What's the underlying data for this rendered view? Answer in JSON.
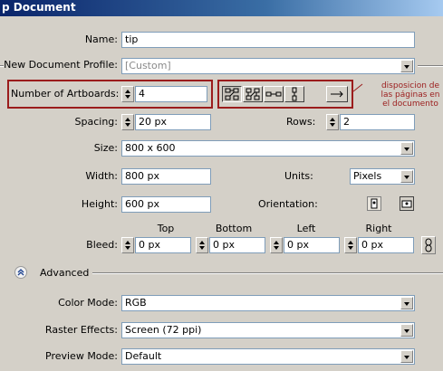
{
  "window": {
    "title": "p Document"
  },
  "name": {
    "label": "Name:",
    "value": "tip"
  },
  "profile": {
    "label": "New Document Profile:",
    "value": "[Custom]"
  },
  "artboards": {
    "label": "Number of Artboards:",
    "value": "4",
    "note": [
      "disposicion de",
      "las páginas en",
      "el documento"
    ]
  },
  "spacing": {
    "label": "Spacing:",
    "value": "20 px"
  },
  "rows": {
    "label": "Rows:",
    "value": "2"
  },
  "size": {
    "label": "Size:",
    "value": "800 x 600"
  },
  "width": {
    "label": "Width:",
    "value": "800 px"
  },
  "units": {
    "label": "Units:",
    "value": "Pixels"
  },
  "height": {
    "label": "Height:",
    "value": "600 px"
  },
  "orientation": {
    "label": "Orientation:"
  },
  "bleed": {
    "label": "Bleed:",
    "top": {
      "label": "Top",
      "value": "0 px"
    },
    "bottom": {
      "label": "Bottom",
      "value": "0 px"
    },
    "left": {
      "label": "Left",
      "value": "0 px"
    },
    "right": {
      "label": "Right",
      "value": "0 px"
    }
  },
  "advanced": {
    "label": "Advanced"
  },
  "color_mode": {
    "label": "Color Mode:",
    "value": "RGB"
  },
  "raster_effects": {
    "label": "Raster Effects:",
    "value": "Screen (72 ppi)"
  },
  "preview_mode": {
    "label": "Preview Mode:",
    "value": "Default"
  },
  "colors": {
    "title_bar": "#0a246a",
    "dialog_bg": "#d4d0c8",
    "highlight": "#9b1c1c"
  }
}
